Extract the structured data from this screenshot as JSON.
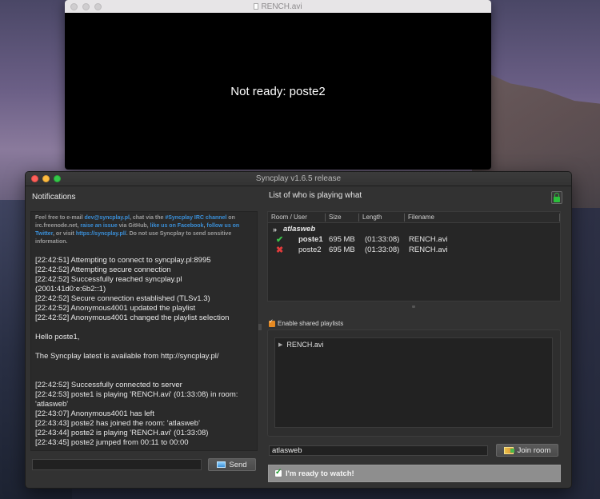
{
  "video": {
    "title": "RENCH.avi",
    "overlay_text": "Not ready: poste2"
  },
  "syncplay": {
    "title": "Syncplay v1.6.5 release",
    "notifications": {
      "title": "Notifications",
      "motd": [
        {
          "text": "Feel free to e-mail ",
          "link": false
        },
        {
          "text": "dev@syncplay.pl",
          "link": true
        },
        {
          "text": ", chat via the ",
          "link": false
        },
        {
          "text": "#Syncplay IRC channel",
          "link": true
        },
        {
          "text": " on irc.freenode.net, ",
          "link": false
        },
        {
          "text": "raise an issue",
          "link": true
        },
        {
          "text": " via GitHub, ",
          "link": false
        },
        {
          "text": "like us on Facebook",
          "link": true
        },
        {
          "text": ", ",
          "link": false
        },
        {
          "text": "follow us on Twitter",
          "link": true
        },
        {
          "text": ", or visit ",
          "link": false
        },
        {
          "text": "https://syncplay.pl/",
          "link": true
        },
        {
          "text": ". Do not use Syncplay to send sensitive information.",
          "link": false
        }
      ],
      "log_block1": [
        "[22:42:51] Attempting to connect to syncplay.pl:8995",
        "[22:42:52] Attempting secure connection",
        "[22:42:52] Successfully reached syncplay.pl (2001:41d0:e:6b2::1)",
        "[22:42:52] Secure connection established (TLSv1.3)",
        "[22:42:52] Anonymous4001 updated the playlist",
        "[22:42:52] Anonymous4001 changed the playlist selection"
      ],
      "greeting": "Hello poste1,",
      "update_notice": "The Syncplay latest is available from http://syncplay.pl/",
      "log_block2": [
        "[22:42:52] Successfully connected to server",
        "[22:42:53] poste1 is playing 'RENCH.avi' (01:33:08) in room: 'atlasweb'",
        "[22:43:07] Anonymous4001 has left",
        "[22:43:43] poste2 has joined the room: 'atlasweb'",
        "[22:43:44] poste2 is playing 'RENCH.avi' (01:33:08)",
        "[22:43:45] poste2 jumped from 00:11 to 00:00"
      ],
      "chat_value": "",
      "send_label": "Send"
    },
    "userlist": {
      "title": "List of who is playing what",
      "headers": {
        "room": "Room / User",
        "size": "Size",
        "length": "Length",
        "filename": "Filename"
      },
      "room_chevron": "»",
      "room_name": "atlasweb",
      "users": [
        {
          "status": "✔",
          "name": "poste1",
          "size": "695 MB",
          "length": "(01:33:08)",
          "filename": "RENCH.avi"
        },
        {
          "status": "✖",
          "name": "poste2",
          "size": "695 MB",
          "length": "(01:33:08)",
          "filename": "RENCH.avi"
        }
      ]
    },
    "playlist": {
      "enable_label": "Enable shared playlists",
      "items": [
        "RENCH.avi"
      ]
    },
    "room_input_value": "atlasweb",
    "join_label": "Join room",
    "ready_label": "I'm ready to watch!"
  }
}
